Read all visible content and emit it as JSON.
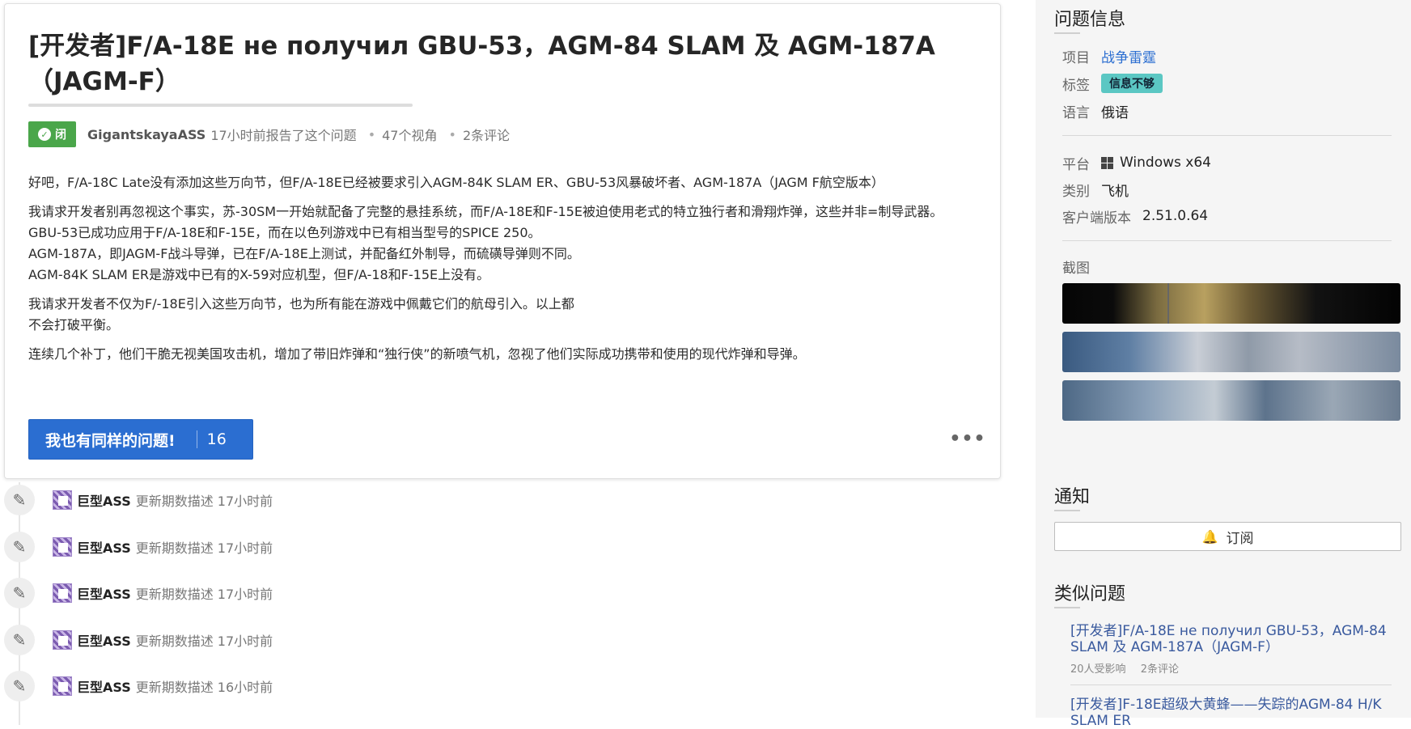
{
  "issue": {
    "title": "[开发者]F/A-18E не получил GBU-53，AGM-84 SLAM 及 AGM-187A（JAGM-F）",
    "status": "闭",
    "author": "GigantskayaASS",
    "reported": "17小时前报告了这个问题",
    "views": "47个视角",
    "comments": "2条评论",
    "paragraphs": [
      "好吧，F/A-18C Late没有添加这些万向节，但F/A-18E已经被要求引入AGM-84K SLAM ER、GBU-53风暴破坏者、AGM-187A（JAGM F航空版本）",
      "我请求开发者别再忽视这个事实，苏-30SM一开始就配备了完整的悬挂系统，而F/A-18E和F-15E被迫使用老式的特立独行者和滑翔炸弹，这些并非=制导武器。",
      "GBU-53已成功应用于F/A-18E和F-15E，而在以色列游戏中已有相当型号的SPICE 250。",
      "AGM-187A，即JAGM-F战斗导弹，已在F/A-18E上测试，并配备红外制导，而硫磺导弹则不同。",
      "AGM-84K SLAM ER是游戏中已有的X-59对应机型，但F/A-18和F-15E上没有。",
      "我请求开发者不仅为F/-18E引入这些万向节，也为所有能在游戏中佩戴它们的航母引入。以上都",
      "不会打破平衡。",
      "连续几个补丁，他们干脆无视美国攻击机，增加了带旧炸弹和“独行侠”的新喷气机，忽视了他们实际成功携带和使用的现代炸弹和导弹。"
    ],
    "same_issue_label": "我也有同样的问题!",
    "same_issue_count": "16",
    "more": "•••"
  },
  "timeline": [
    {
      "user": "巨型ASS",
      "text": "更新期数描述 17小时前"
    },
    {
      "user": "巨型ASS",
      "text": "更新期数描述 17小时前"
    },
    {
      "user": "巨型ASS",
      "text": "更新期数描述 17小时前"
    },
    {
      "user": "巨型ASS",
      "text": "更新期数描述 17小时前"
    },
    {
      "user": "巨型ASS",
      "text": "更新期数描述 16小时前"
    }
  ],
  "sidebar": {
    "info_heading": "问题信息",
    "project_label": "项目",
    "project_value": "战争雷霆",
    "tags_label": "标签",
    "tag_value": "信息不够",
    "language_label": "语言",
    "language_value": "俄语",
    "platform_label": "平台",
    "platform_value": "Windows x64",
    "category_label": "类别",
    "category_value": "飞机",
    "client_label": "客户端版本",
    "client_value": "2.51.0.64",
    "screenshots_label": "截图",
    "notify_heading": "通知",
    "subscribe_label": "订阅",
    "similar_heading": "类似问题",
    "similar": [
      {
        "title": "[开发者]F/A-18E не получил GBU-53，AGM-84 SLAM 及 AGM-187A（JAGM-F）",
        "affected": "20人受影响",
        "comments": "2条评论"
      },
      {
        "title": "[开发者]F-18E超级大黄蜂——失踪的AGM-84 H/K SLAM ER"
      }
    ]
  },
  "icons": {
    "check": "check-icon",
    "pencil": "pencil-icon",
    "windows": "windows-icon",
    "bell": "bell-icon",
    "more": "ellipsis-icon"
  }
}
